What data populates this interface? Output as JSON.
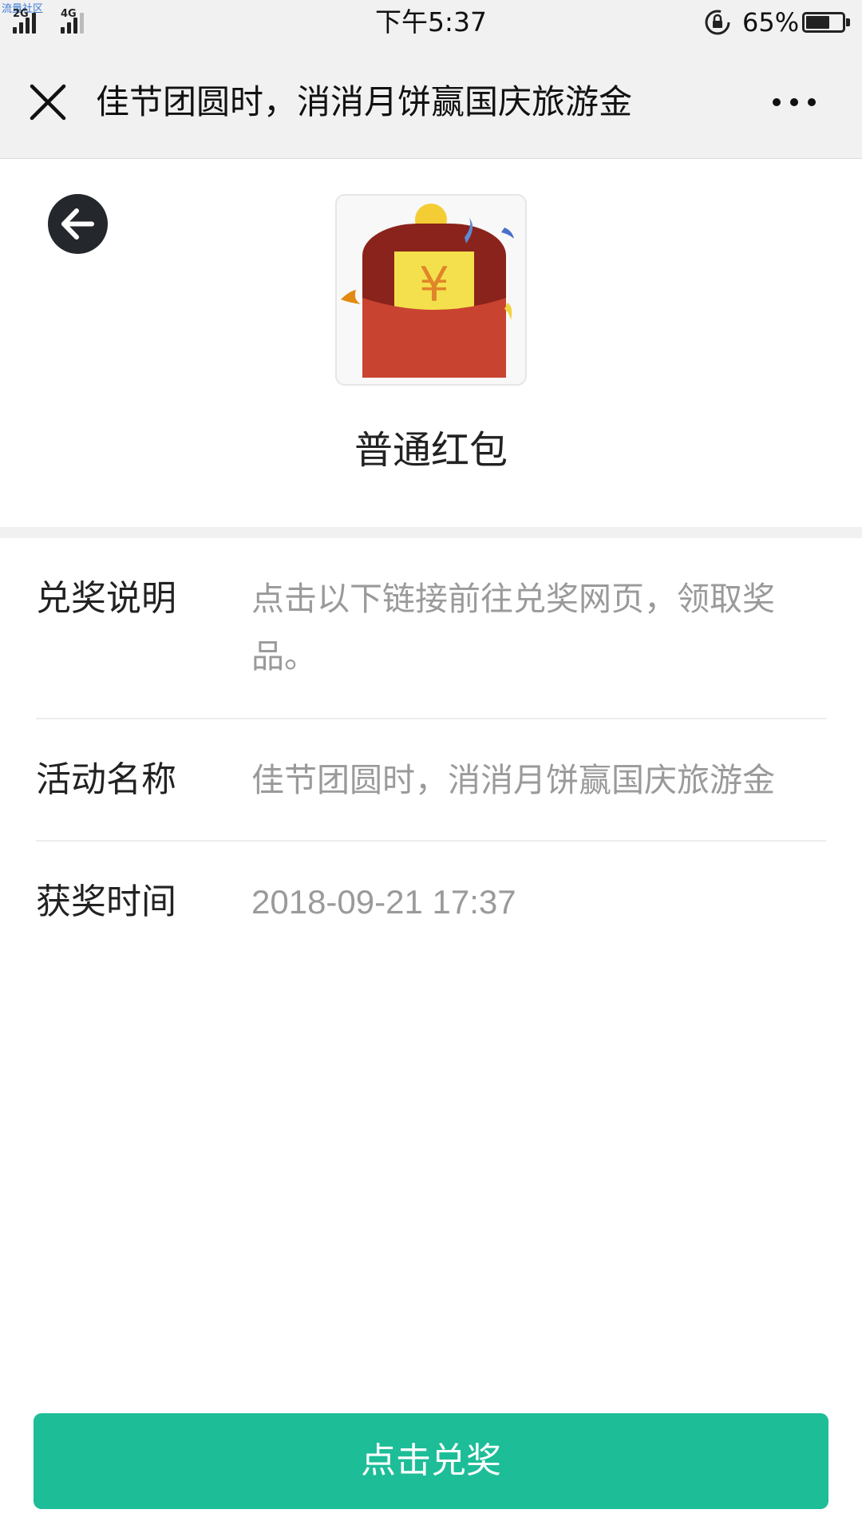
{
  "status_bar": {
    "watermark": "流量社区",
    "network_1": "2G",
    "network_2": "4G",
    "time": "下午5:37",
    "battery_percent": "65%",
    "battery_level": 0.65
  },
  "nav_bar": {
    "title": "佳节团圆时，消消月饼赢国庆旅游金",
    "close_icon": "close-icon",
    "more_icon": "more-icon"
  },
  "prize": {
    "name": "普通红包",
    "image_icon": "red-envelope-icon",
    "currency_symbol": "¥"
  },
  "info": {
    "desc_label": "兑奖说明",
    "desc_value": "点击以下链接前往兑奖网页，领取奖品。",
    "activity_label": "活动名称",
    "activity_value": "佳节团圆时，消消月饼赢国庆旅游金",
    "time_label": "获奖时间",
    "time_value": "2018-09-21 17:37"
  },
  "actions": {
    "redeem_label": "点击兑奖",
    "accent_color": "#1dbd98"
  }
}
